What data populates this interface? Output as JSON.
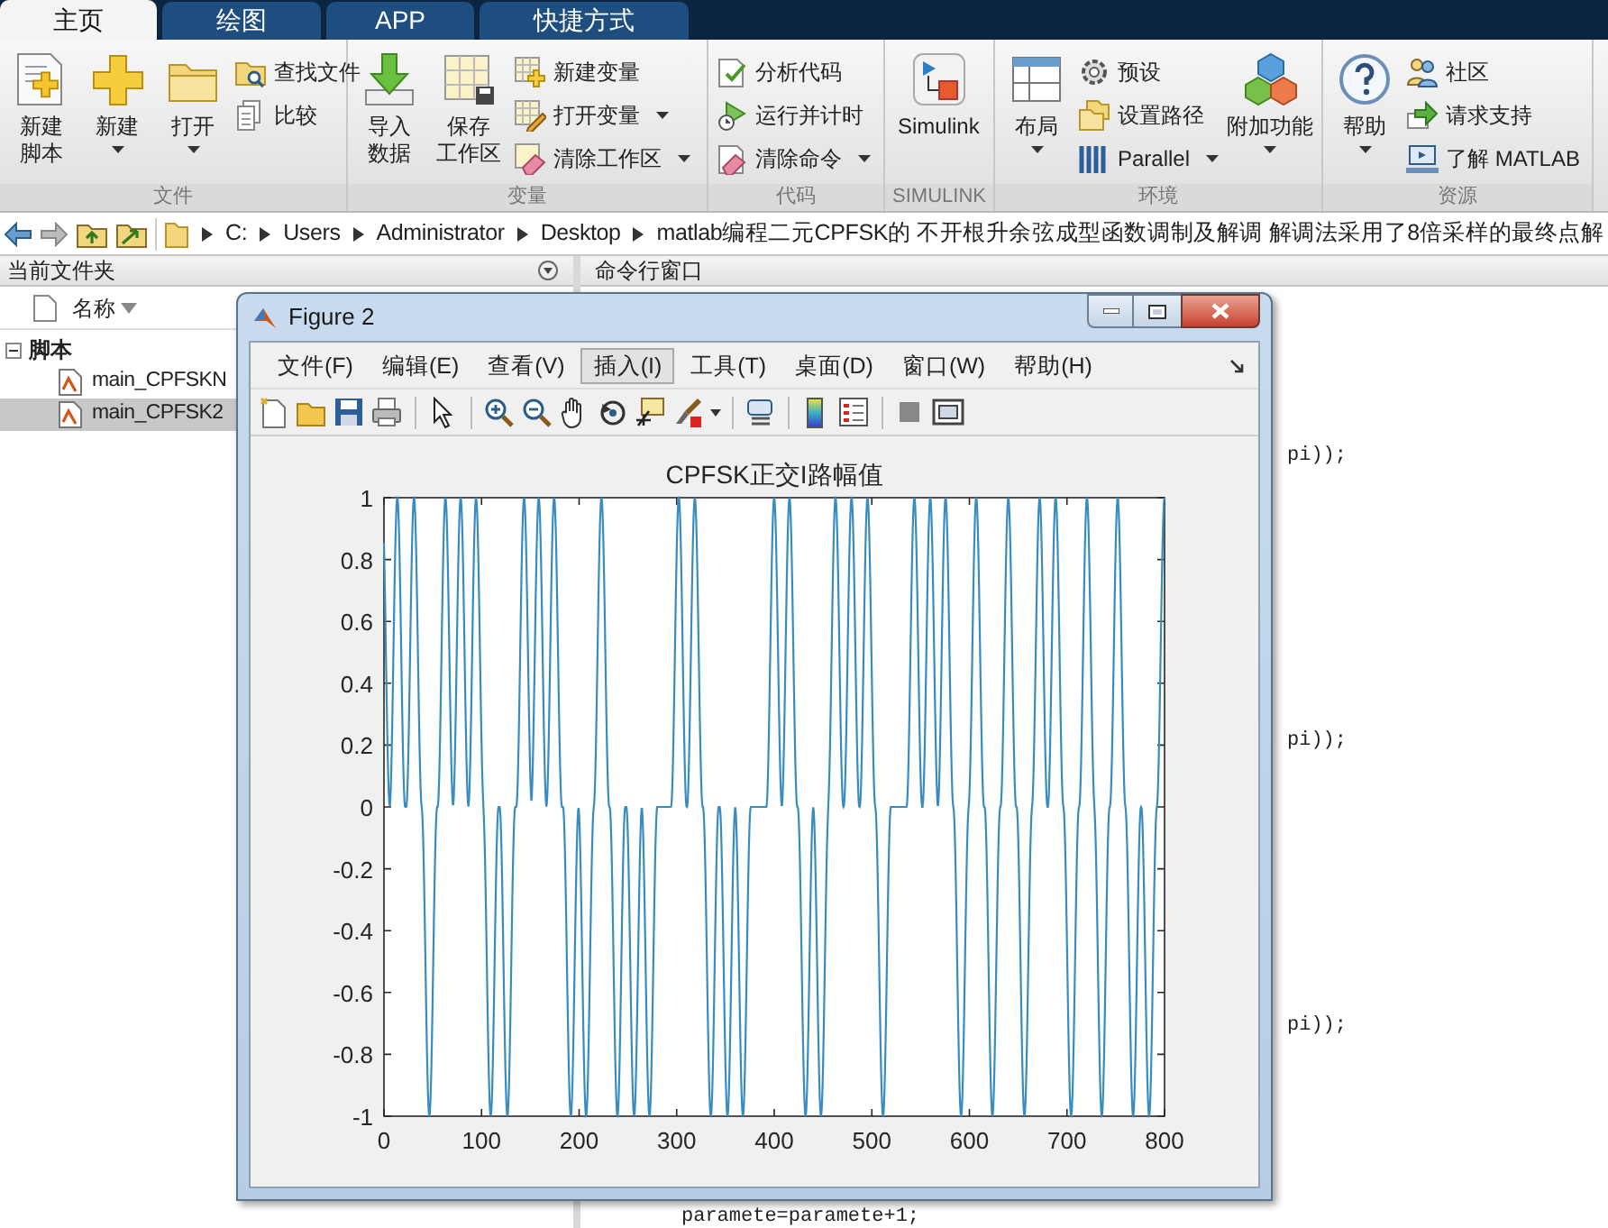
{
  "tabs": [
    {
      "label": "主页",
      "selected": true
    },
    {
      "label": "绘图",
      "selected": false
    },
    {
      "label": "APP",
      "selected": false
    },
    {
      "label": "快捷方式",
      "selected": false
    }
  ],
  "ribbon": [
    {
      "label": "文件",
      "items": [
        {
          "kind": "large",
          "lines": [
            "新建",
            "脚本"
          ],
          "dropdown": false
        },
        {
          "kind": "large",
          "lines": [
            "新建"
          ],
          "dropdown": true
        },
        {
          "kind": "large",
          "lines": [
            "打开"
          ],
          "dropdown": true
        },
        {
          "kind": "stack",
          "items": [
            {
              "label": "查找文件",
              "dropdown": false
            },
            {
              "label": "比较",
              "dropdown": false
            }
          ]
        }
      ]
    },
    {
      "label": "变量",
      "items": [
        {
          "kind": "large",
          "lines": [
            "导入",
            "数据"
          ],
          "dropdown": false
        },
        {
          "kind": "large",
          "lines": [
            "保存",
            "工作区"
          ],
          "dropdown": false
        },
        {
          "kind": "stack",
          "items": [
            {
              "label": "新建变量",
              "dropdown": false
            },
            {
              "label": "打开变量",
              "dropdown": true
            },
            {
              "label": "清除工作区",
              "dropdown": true
            }
          ]
        }
      ]
    },
    {
      "label": "代码",
      "items": [
        {
          "kind": "stack",
          "items": [
            {
              "label": "分析代码",
              "dropdown": false
            },
            {
              "label": "运行并计时",
              "dropdown": false
            },
            {
              "label": "清除命令",
              "dropdown": true
            }
          ]
        }
      ]
    },
    {
      "label": "SIMULINK",
      "items": [
        {
          "kind": "large",
          "lines": [
            "Simulink"
          ],
          "dropdown": false
        }
      ]
    },
    {
      "label": "环境",
      "items": [
        {
          "kind": "large",
          "lines": [
            "布局"
          ],
          "dropdown": true
        },
        {
          "kind": "stack",
          "items": [
            {
              "label": "预设",
              "dropdown": false
            },
            {
              "label": "设置路径",
              "dropdown": false
            },
            {
              "label": "Parallel",
              "dropdown": true
            }
          ]
        },
        {
          "kind": "large",
          "lines": [
            "附加功能"
          ],
          "dropdown": true
        }
      ]
    },
    {
      "label": "资源",
      "items": [
        {
          "kind": "large",
          "lines": [
            "帮助"
          ],
          "dropdown": true
        },
        {
          "kind": "stack",
          "items": [
            {
              "label": "社区",
              "dropdown": false
            },
            {
              "label": "请求支持",
              "dropdown": false
            },
            {
              "label": "了解 MATLAB",
              "dropdown": false
            }
          ]
        }
      ]
    }
  ],
  "address_bar": {
    "path": [
      "C:",
      "Users",
      "Administrator",
      "Desktop",
      "matlab编程二元CPFSK的 不开根升余弦成型函数调制及解调 解调法采用了8倍采样的最终点解"
    ]
  },
  "current_folder": {
    "title": "当前文件夹",
    "column": "名称",
    "tree": [
      {
        "label": "脚本",
        "expanded": true,
        "children": [
          {
            "label": "main_CPFSKN",
            "selected": false
          },
          {
            "label": "main_CPFSK2",
            "selected": true
          }
        ]
      }
    ]
  },
  "command_window": {
    "title": "命令行窗口",
    "lines": [
      {
        "text": "pi));"
      },
      {
        "text": "pi));"
      },
      {
        "text": "pi));"
      },
      {
        "text": "paramete=paramete+1;"
      }
    ]
  },
  "figure": {
    "title": "Figure 2",
    "menu": [
      {
        "label": "文件(F)",
        "selected": false
      },
      {
        "label": "编辑(E)",
        "selected": false
      },
      {
        "label": "查看(V)",
        "selected": false
      },
      {
        "label": "插入(I)",
        "selected": true
      },
      {
        "label": "工具(T)",
        "selected": false
      },
      {
        "label": "桌面(D)",
        "selected": false
      },
      {
        "label": "窗口(W)",
        "selected": false
      },
      {
        "label": "帮助(H)",
        "selected": false
      }
    ],
    "plot": {
      "title": "CPFSK正交I路幅值",
      "yticks": [
        "1",
        "0.8",
        "0.6",
        "0.4",
        "0.2",
        "0",
        "-0.2",
        "-0.4",
        "-0.6",
        "-0.8",
        "-1"
      ],
      "xticks": [
        "0",
        "100",
        "200",
        "300",
        "400",
        "500",
        "600",
        "700",
        "800"
      ]
    }
  }
}
